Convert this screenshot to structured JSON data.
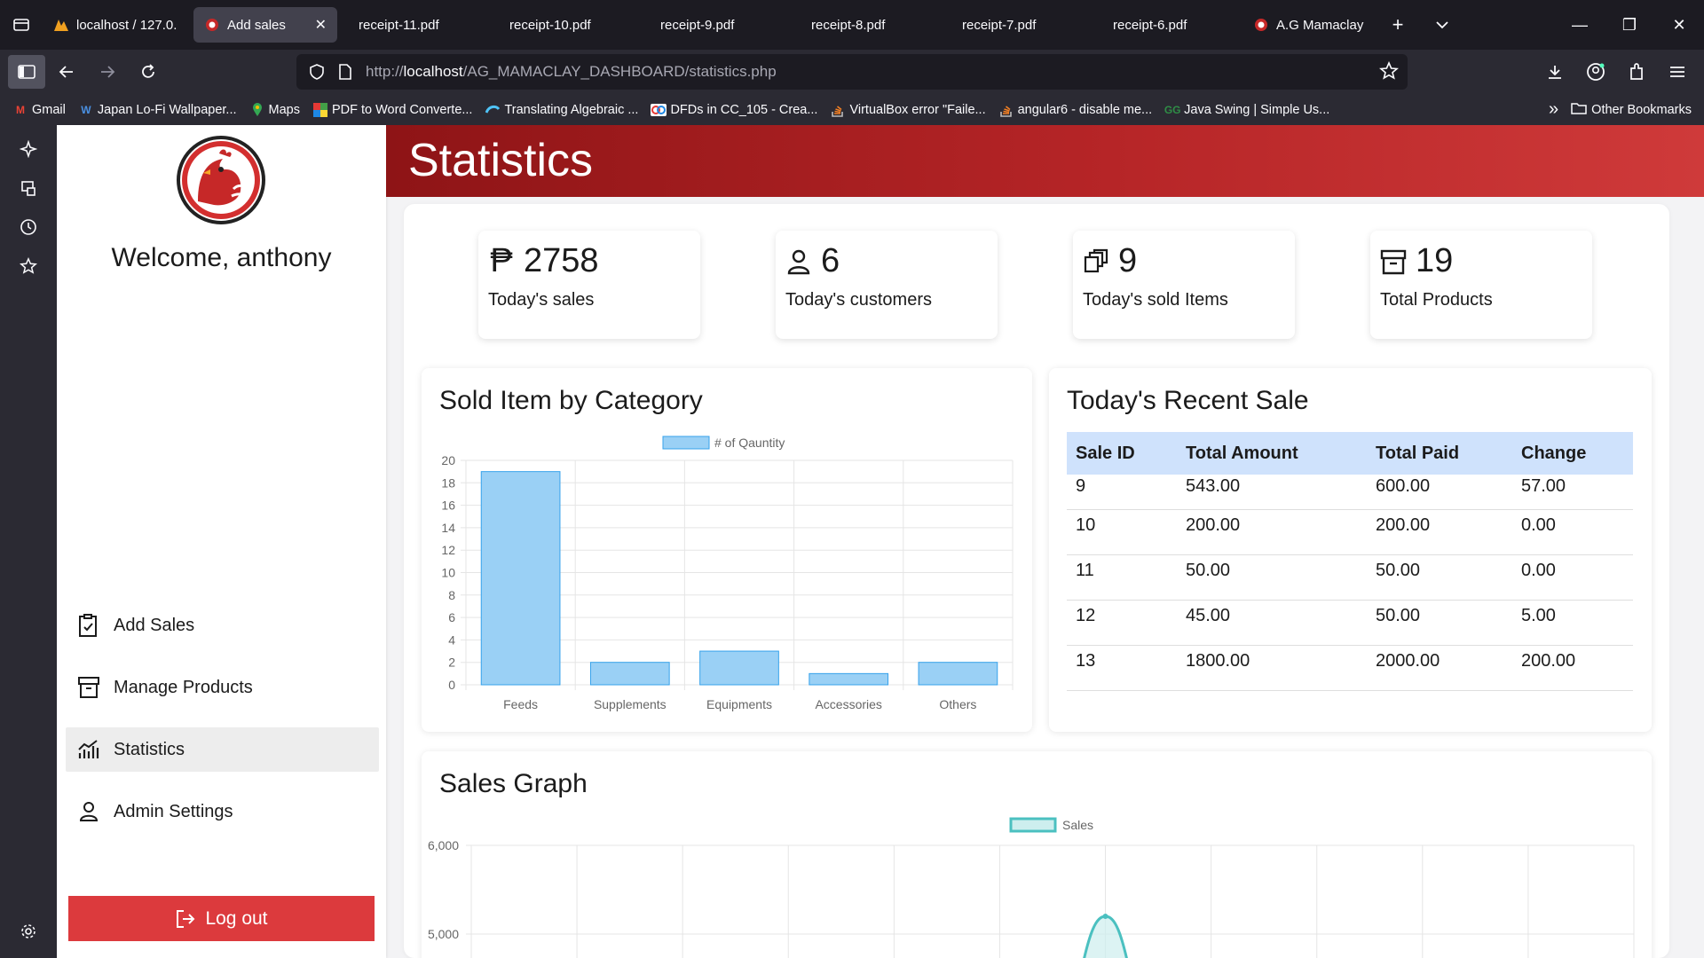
{
  "browser": {
    "tabs": [
      {
        "title": "localhost / 127.0.0",
        "active": false
      },
      {
        "title": "Add sales",
        "active": true
      },
      {
        "title": "receipt-11.pdf",
        "active": false
      },
      {
        "title": "receipt-10.pdf",
        "active": false
      },
      {
        "title": "receipt-9.pdf",
        "active": false
      },
      {
        "title": "receipt-8.pdf",
        "active": false
      },
      {
        "title": "receipt-7.pdf",
        "active": false
      },
      {
        "title": "receipt-6.pdf",
        "active": false
      },
      {
        "title": "A.G Mamaclay Po",
        "active": false
      }
    ],
    "url_prefix": "http://",
    "url_host": "localhost",
    "url_path": "/AG_MAMACLAY_DASHBOARD/statistics.php",
    "bookmarks": [
      {
        "label": "Gmail",
        "icon": "gmail-icon"
      },
      {
        "label": "Japan Lo-Fi Wallpaper...",
        "icon": "w-icon"
      },
      {
        "label": "Maps",
        "icon": "maps-icon"
      },
      {
        "label": "PDF to Word Converte...",
        "icon": "pdf-icon"
      },
      {
        "label": "Translating Algebraic ...",
        "icon": "translate-icon"
      },
      {
        "label": "DFDs in CC_105 - Crea...",
        "icon": "dfd-icon"
      },
      {
        "label": "VirtualBox error \"Faile...",
        "icon": "stackoverflow-icon"
      },
      {
        "label": "angular6 - disable me...",
        "icon": "stackoverflow-icon"
      },
      {
        "label": "Java Swing | Simple Us...",
        "icon": "geeks-icon"
      }
    ],
    "other_bookmarks": "Other Bookmarks"
  },
  "sidebar": {
    "welcome": "Welcome, anthony",
    "menu": [
      {
        "label": "Add Sales",
        "icon": "clipboard-check-icon",
        "active": false
      },
      {
        "label": "Manage Products",
        "icon": "archive-box-icon",
        "active": false
      },
      {
        "label": "Statistics",
        "icon": "graph-icon",
        "active": true
      },
      {
        "label": "Admin Settings",
        "icon": "user-icon",
        "active": false
      }
    ],
    "logout": "Log out"
  },
  "header": {
    "title": "Statistics"
  },
  "stats": [
    {
      "value": "2758",
      "prefix": "₱",
      "label": "Today's sales",
      "icon": "peso-icon"
    },
    {
      "value": "6",
      "label": "Today's customers",
      "icon": "person-icon"
    },
    {
      "value": "9",
      "label": "Today's sold Items",
      "icon": "boxes-icon"
    },
    {
      "value": "19",
      "label": "Total Products",
      "icon": "archive-icon"
    }
  ],
  "category_panel": {
    "title": "Sold Item by Category"
  },
  "recent_sale": {
    "title": "Today's Recent Sale",
    "columns": [
      "Sale ID",
      "Total Amount",
      "Total Paid",
      "Change"
    ],
    "rows": [
      [
        "9",
        "543.00",
        "600.00",
        "57.00"
      ],
      [
        "10",
        "200.00",
        "200.00",
        "0.00"
      ],
      [
        "11",
        "50.00",
        "50.00",
        "0.00"
      ],
      [
        "12",
        "45.00",
        "50.00",
        "5.00"
      ],
      [
        "13",
        "1800.00",
        "2000.00",
        "200.00"
      ]
    ]
  },
  "sales_panel": {
    "title": "Sales Graph"
  },
  "chart_data": [
    {
      "type": "bar",
      "title": "Sold Item by Category",
      "categories": [
        "Feeds",
        "Supplements",
        "Equipments",
        "Accessories",
        "Others"
      ],
      "series": [
        {
          "name": "# of Qauntity",
          "values": [
            19,
            2,
            3,
            1,
            2
          ]
        }
      ],
      "ylim": [
        0,
        20
      ],
      "yticks": [
        0,
        2,
        4,
        6,
        8,
        10,
        12,
        14,
        16,
        18,
        20
      ],
      "legend": "top-center",
      "grid": true,
      "colors": {
        "fill": "#9ad0f5",
        "stroke": "#36a2eb"
      }
    },
    {
      "type": "line",
      "title": "Sales Graph",
      "series": [
        {
          "name": "Sales"
        }
      ],
      "yticks_visible": [
        "6,000",
        "5,000"
      ],
      "visible_peak": 5200,
      "legend": "top-center",
      "grid": true,
      "colors": {
        "fill": "#cdeeee",
        "stroke": "#4bc0c0"
      }
    }
  ]
}
